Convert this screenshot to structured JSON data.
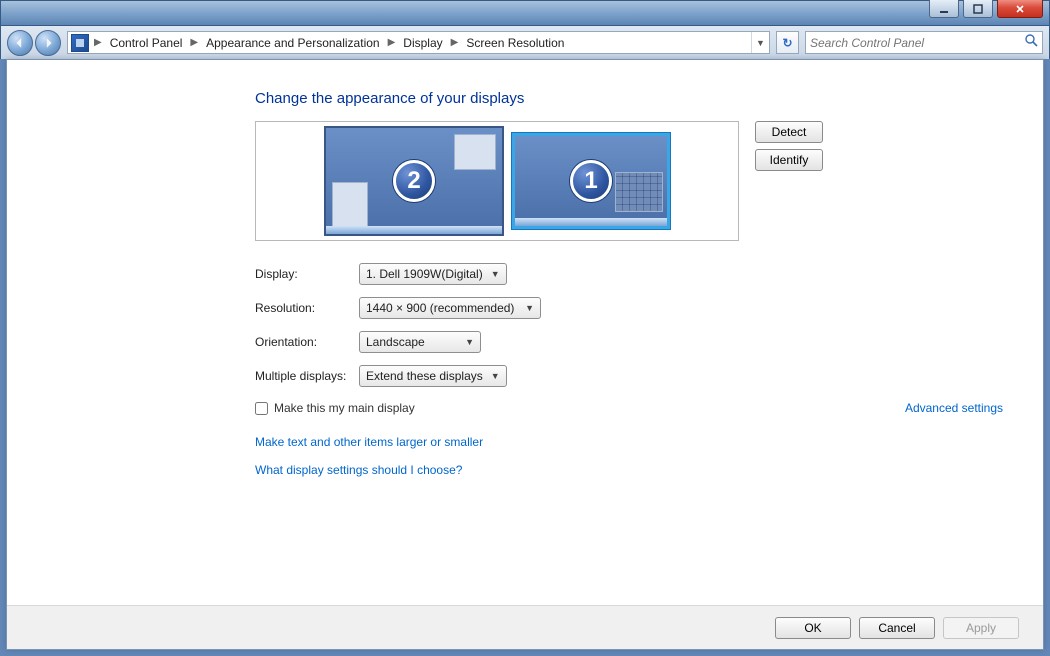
{
  "titlebar": {
    "minimize_tip": "Minimize",
    "maximize_tip": "Maximize",
    "close_tip": "Close"
  },
  "nav": {
    "breadcrumb": [
      "Control Panel",
      "Appearance and Personalization",
      "Display",
      "Screen Resolution"
    ],
    "search_placeholder": "Search Control Panel",
    "refresh_tip": "Refresh"
  },
  "page": {
    "title": "Change the appearance of your displays",
    "monitors": {
      "primary_badge": "1",
      "secondary_badge": "2"
    },
    "detect_label": "Detect",
    "identify_label": "Identify",
    "fields": {
      "display_label": "Display:",
      "display_value": "1. Dell 1909W(Digital)",
      "resolution_label": "Resolution:",
      "resolution_value": "1440 × 900 (recommended)",
      "orientation_label": "Orientation:",
      "orientation_value": "Landscape",
      "multiple_label": "Multiple displays:",
      "multiple_value": "Extend these displays"
    },
    "main_display_checkbox": "Make this my main display",
    "advanced_link": "Advanced settings",
    "help_links": [
      "Make text and other items larger or smaller",
      "What display settings should I choose?"
    ]
  },
  "footer": {
    "ok": "OK",
    "cancel": "Cancel",
    "apply": "Apply"
  }
}
